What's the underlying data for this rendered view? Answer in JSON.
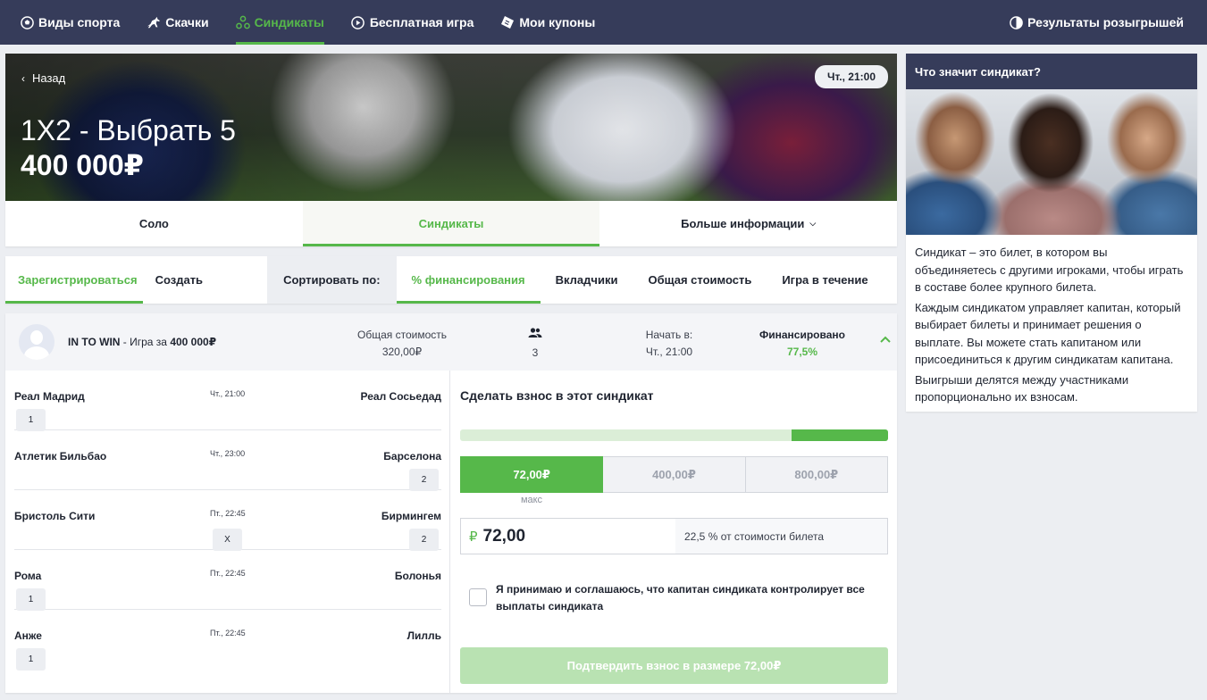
{
  "nav": {
    "items": [
      {
        "label": "Виды спорта",
        "icon": "soccer-ball-icon"
      },
      {
        "label": "Скачки",
        "icon": "horse-icon"
      },
      {
        "label": "Синдикаты",
        "icon": "syndicate-icon",
        "active": true
      },
      {
        "label": "Бесплатная игра",
        "icon": "play-circle-icon"
      },
      {
        "label": "Мои купоны",
        "icon": "ticket-icon"
      }
    ],
    "results": {
      "label": "Результаты розыгрышей",
      "icon": "pie-chart-icon"
    }
  },
  "hero": {
    "back_label": "Назад",
    "title": "1X2 - Выбрать 5",
    "prize": "400 000₽",
    "time_badge": "Чт., 21:00"
  },
  "tabs": [
    {
      "label": "Соло"
    },
    {
      "label": "Синдикаты",
      "active": true
    },
    {
      "label": "Больше информации"
    }
  ],
  "filters": {
    "register": "Зарегистрироваться",
    "create": "Создать",
    "sort_label": "Сортировать по:",
    "sort_options": [
      "% финансирования",
      "Вкладчики",
      "Общая стоимость",
      "Игра в течение"
    ]
  },
  "syndicate": {
    "name": "IN TO WIN",
    "game_prefix": " - Игра за ",
    "game_prize": "400 000₽",
    "total_cost_label": "Общая стоимость",
    "total_cost_value": "320,00₽",
    "contributors_value": "3",
    "start_label": "Начать в:",
    "start_value": "Чт., 21:00",
    "funded_label": "Финансировано",
    "funded_value": "77,5%"
  },
  "matches": [
    {
      "home": "Реал Мадрид",
      "time": "Чт., 21:00",
      "away": "Реал Сосьедад",
      "picks": [
        "1"
      ]
    },
    {
      "home": "Атлетик Бильбао",
      "time": "Чт., 23:00",
      "away": "Барселона",
      "picks": [
        "2"
      ]
    },
    {
      "home": "Бристоль Сити",
      "time": "Пт., 22:45",
      "away": "Бирмингем",
      "picks": [
        "X",
        "2"
      ]
    },
    {
      "home": "Рома",
      "time": "Пт., 22:45",
      "away": "Болонья",
      "picks": [
        "1"
      ]
    },
    {
      "home": "Анже",
      "time": "Пт., 22:45",
      "away": "Лилль",
      "picks": [
        "1"
      ]
    }
  ],
  "contribution": {
    "title": "Сделать взнос в этот синдикат",
    "progress_fraction": 0.225,
    "amounts": [
      "72,00₽",
      "400,00₽",
      "800,00₽"
    ],
    "max_label": "макс",
    "currency_symbol": "₽",
    "input_value": "72,00",
    "percent_text": "22,5 % от стоимости билета",
    "agree_text": "Я принимаю и соглашаюсь, что капитан синдиката контролирует все выплаты синдиката",
    "confirm_label": "Подтвердить взнос в размере 72,00₽"
  },
  "side": {
    "title": "Что значит синдикат?",
    "paragraphs": [
      "Синдикат – это билет, в котором вы объединяетесь с другими игроками, чтобы играть в составе более крупного билета.",
      "Каждым синдикатом управляет капитан, который выбирает билеты и принимает решения о выплате. Вы можете стать капитаном или присоединиться к другим синдикатам капитана.",
      "Выигрыши делятся между участниками пропорционально их взносам."
    ]
  },
  "colors": {
    "accent": "#56b84a",
    "nav_bg": "#363c5a",
    "page_bg": "#eceef2"
  }
}
